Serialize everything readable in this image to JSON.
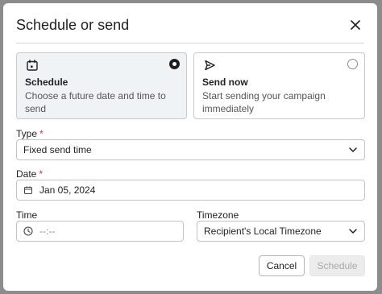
{
  "dialog": {
    "title": "Schedule or send"
  },
  "options": [
    {
      "title": "Schedule",
      "description": "Choose a future date and time to send",
      "selected": true,
      "icon": "calendar-icon"
    },
    {
      "title": "Send now",
      "description": "Start sending your campaign immediately",
      "selected": false,
      "icon": "send-icon"
    }
  ],
  "form": {
    "type": {
      "label": "Type",
      "required_mark": "*",
      "value": "Fixed send time"
    },
    "date": {
      "label": "Date",
      "required_mark": "*",
      "value": "Jan 05, 2024"
    },
    "time": {
      "label": "Time",
      "placeholder": "--:--"
    },
    "timezone": {
      "label": "Timezone",
      "value": "Recipient's Local Timezone"
    }
  },
  "actions": {
    "cancel_label": "Cancel",
    "schedule_label": "Schedule"
  },
  "colors": {
    "required": "#d0342c",
    "selected_card_bg": "#eff3f5",
    "disabled_button_bg": "#ececec"
  }
}
